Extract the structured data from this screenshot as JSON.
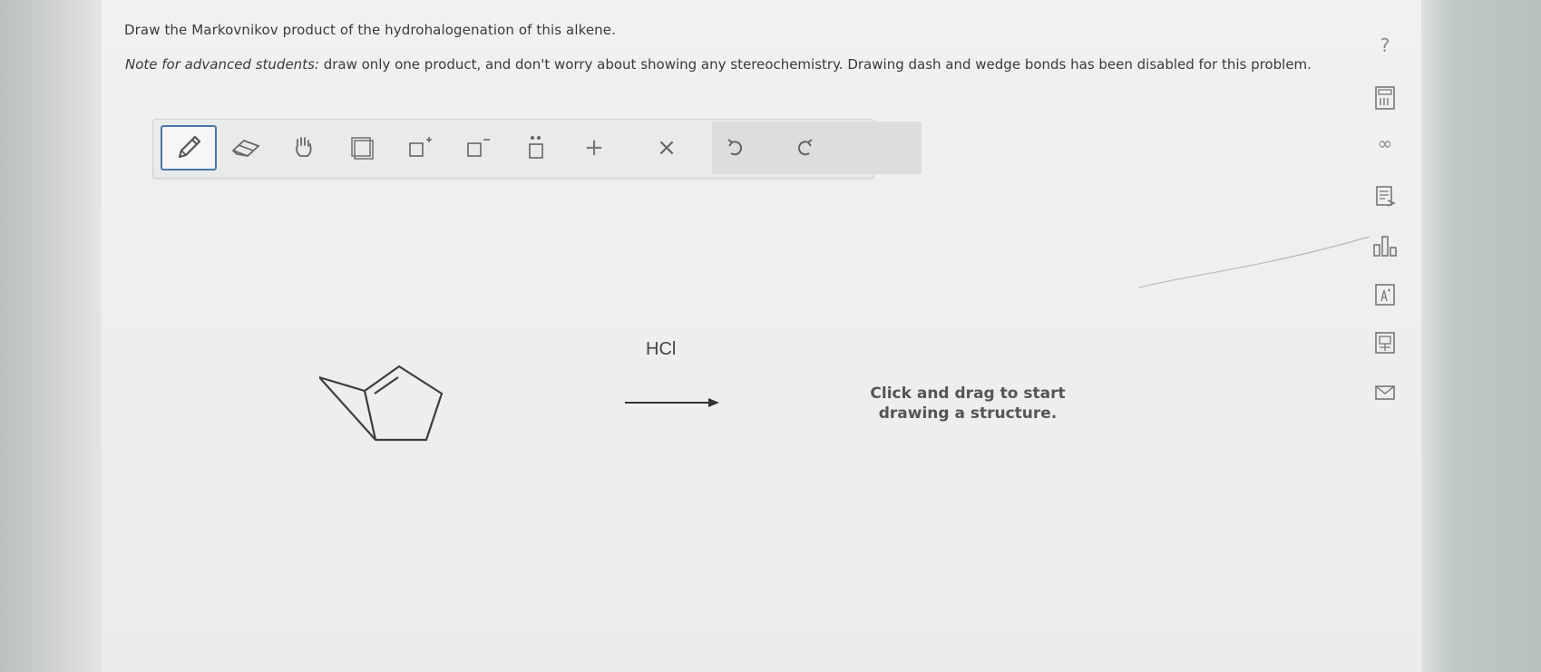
{
  "question": {
    "text": "Draw the Markovnikov product of the hydrohalogenation of this alkene."
  },
  "note": {
    "label": "Note for advanced students:",
    "text": " draw only one product, and don't worry about showing any stereochemistry. Drawing dash and wedge bonds has been disabled for this problem."
  },
  "toolbar": {
    "plus_label": "+",
    "delete_label": "×"
  },
  "reaction": {
    "reagent": "HCl"
  },
  "canvas": {
    "hint_line1": "Click and drag to start",
    "hint_line2": "drawing a structure."
  },
  "side_tools": {
    "help_label": "?",
    "periodic_label": "∞"
  },
  "icons": [
    "pencil-icon",
    "eraser-icon",
    "hand-icon",
    "template-icon",
    "positive-charge-icon",
    "negative-charge-icon",
    "lone-pair-icon",
    "plus-icon",
    "delete-icon",
    "undo-icon",
    "redo-icon",
    "calculator-icon",
    "book-icon",
    "chart-icon",
    "periodic-table-icon",
    "reference-icon",
    "mail-icon"
  ]
}
